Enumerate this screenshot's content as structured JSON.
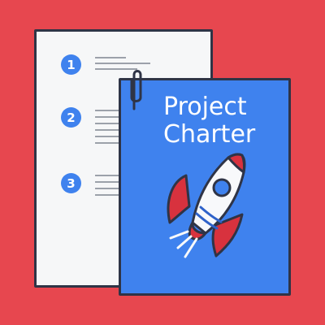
{
  "illustration": {
    "background_color": "#e7474f",
    "outline_color": "#2f3446"
  },
  "checklist_sheet": {
    "background_color": "#f6f7f8",
    "accent_color": "#3f82ee",
    "steps": [
      {
        "number": "1"
      },
      {
        "number": "2"
      },
      {
        "number": "3"
      }
    ]
  },
  "charter_sheet": {
    "background_color": "#3f82ee",
    "title_lines": [
      "Project",
      "Charter"
    ],
    "icons": [
      "paperclip-icon",
      "rocket-icon"
    ]
  },
  "rocket": {
    "body_color": "#f8f9fb",
    "fin_color": "#d8323e",
    "window_color": "#3f82ee",
    "stripe_color": "#2f62c9"
  }
}
